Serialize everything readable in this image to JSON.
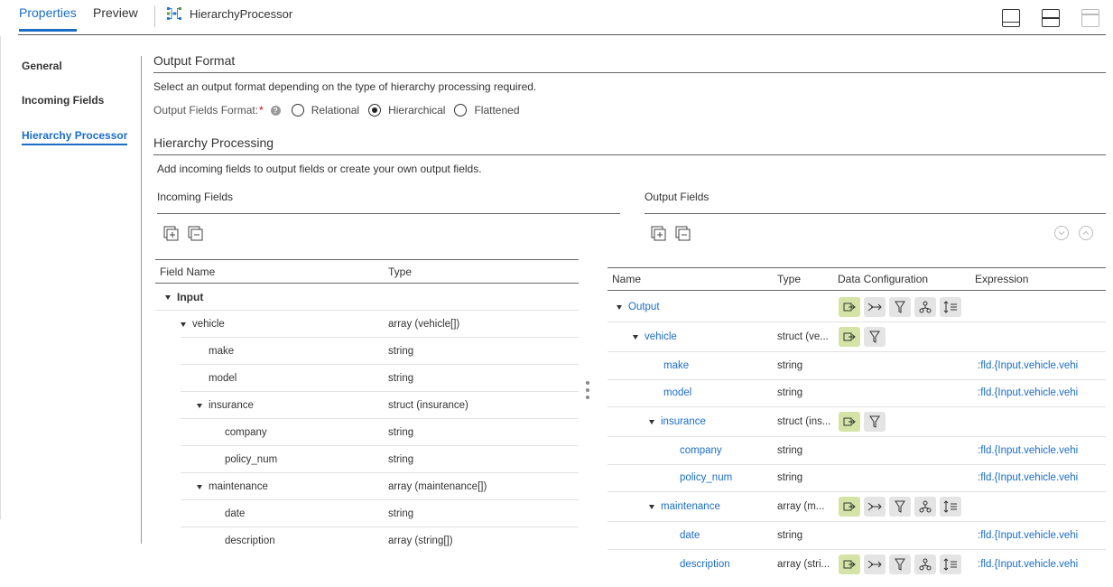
{
  "tabs": {
    "properties": "Properties",
    "preview": "Preview"
  },
  "processor_title": "HierarchyProcessor",
  "sidebar": [
    {
      "label": "General"
    },
    {
      "label": "Incoming Fields"
    },
    {
      "label": "Hierarchy Processor"
    }
  ],
  "output_format": {
    "title": "Output Format",
    "description": "Select an output format depending on the type of hierarchy processing required.",
    "field_label": "Output Fields Format:",
    "required_mark": "*",
    "help_glyph": "?",
    "options": [
      "Relational",
      "Hierarchical",
      "Flattened"
    ],
    "selected": "Hierarchical"
  },
  "hierarchy": {
    "title": "Hierarchy Processing",
    "description": "Add incoming fields to output fields or create your own output fields."
  },
  "incoming": {
    "title": "Incoming Fields",
    "headers": {
      "name": "Field Name",
      "type": "Type"
    },
    "rows": [
      {
        "name": "Input",
        "type": ""
      },
      {
        "name": "vehicle",
        "type": "array (vehicle[])"
      },
      {
        "name": "make",
        "type": "string"
      },
      {
        "name": "model",
        "type": "string"
      },
      {
        "name": "insurance",
        "type": "struct (insurance)"
      },
      {
        "name": "company",
        "type": "string"
      },
      {
        "name": "policy_num",
        "type": "string"
      },
      {
        "name": "maintenance",
        "type": "array (maintenance[])"
      },
      {
        "name": "date",
        "type": "string"
      },
      {
        "name": "description",
        "type": "array (string[])"
      }
    ]
  },
  "output": {
    "title": "Output Fields",
    "headers": {
      "name": "Name",
      "type": "Type",
      "config": "Data Configuration",
      "expr": "Expression"
    },
    "rows": [
      {
        "name": "Output",
        "type": "",
        "expr": ""
      },
      {
        "name": "vehicle",
        "type": "struct (ve...",
        "expr": ""
      },
      {
        "name": "make",
        "type": "string",
        "expr": ":fld.{Input.vehicle.vehi"
      },
      {
        "name": "model",
        "type": "string",
        "expr": ":fld.{Input.vehicle.vehi"
      },
      {
        "name": "insurance",
        "type": "struct (ins...",
        "expr": ""
      },
      {
        "name": "company",
        "type": "string",
        "expr": ":fld.{Input.vehicle.vehi"
      },
      {
        "name": "policy_num",
        "type": "string",
        "expr": ":fld.{Input.vehicle.vehi"
      },
      {
        "name": "maintenance",
        "type": "array (m...",
        "expr": ""
      },
      {
        "name": "date",
        "type": "string",
        "expr": ":fld.{Input.vehicle.vehi"
      },
      {
        "name": "description",
        "type": "array (stri...",
        "expr": ":fld.{Input.vehicle.vehi"
      }
    ]
  },
  "colors": {
    "accent": "#1a6dc7",
    "config_active": "#d5e4a6",
    "config_inactive": "#e4e4e4"
  }
}
